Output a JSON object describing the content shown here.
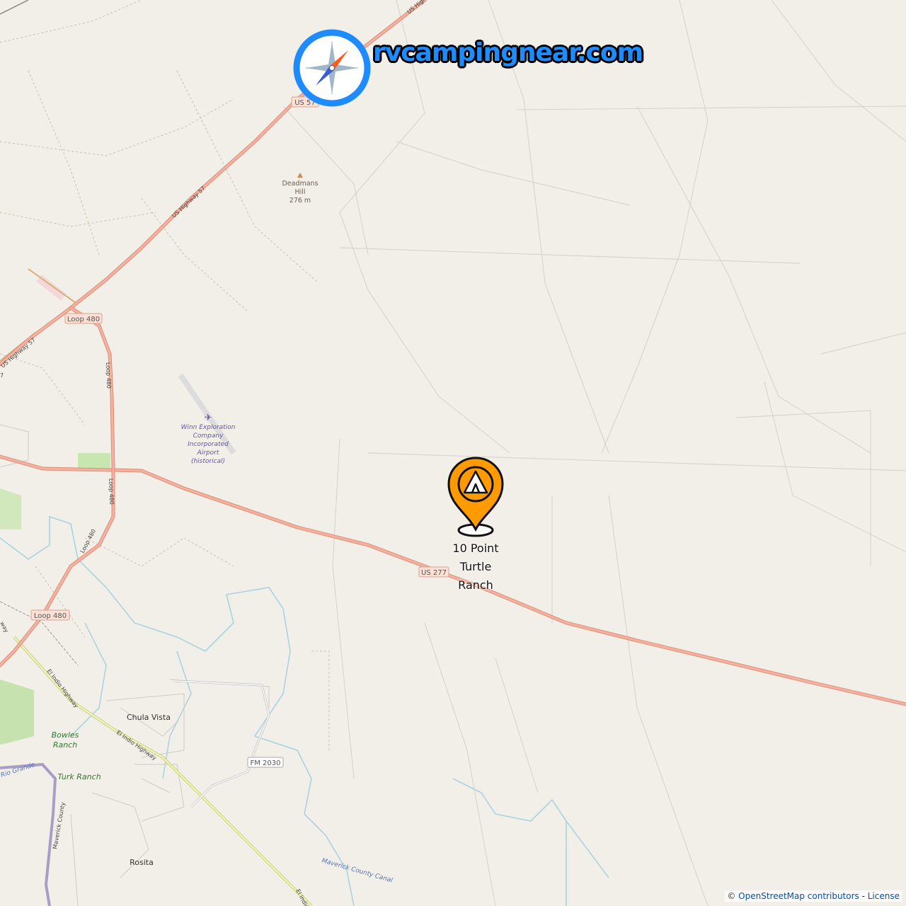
{
  "brand": {
    "site_name": "rvcampingnear.com",
    "colors": {
      "ring": "#1e8cff",
      "text": "#1e8cff",
      "needle_north": "#ff5a1f",
      "needle_south": "#3a5bd9"
    },
    "icon": "compass-icon"
  },
  "marker": {
    "name_lines": [
      "10 Point",
      "Turtle",
      "Ranch"
    ],
    "icon": "tent-pin-icon",
    "color": "#ff9a00"
  },
  "road_shields": [
    {
      "id": "us57-top",
      "text": "US 57"
    },
    {
      "id": "loop480-north",
      "text": "Loop 480"
    },
    {
      "id": "us277",
      "text": "US 277"
    },
    {
      "id": "loop480-south",
      "text": "Loop 480"
    },
    {
      "id": "fm2030",
      "text": "FM 2030"
    }
  ],
  "road_labels": {
    "us_hwy_57_a": "US Highway 57",
    "us_hwy_57_b": "US Highway 57",
    "us_hwy_57_top": "US Highw",
    "loop_480_a": "Loop 480",
    "loop_480_b": "Loop 480",
    "loop_480_c": "Loop 480",
    "el_indio_a": "El Indio Highway",
    "el_indio_b": "El Indio Highway",
    "el_indio_c": "El Indio H",
    "maverick_canal": "Maverick County Canal",
    "maverick_county": "Maverick County",
    "rio_grande": "Rio Grande",
    "edge_7": "7",
    "edge_way": "way"
  },
  "places": {
    "deadmans_hill": [
      "Deadmans",
      "Hill",
      "276 m"
    ],
    "airport": [
      "Winn Exploration",
      "Company",
      "Incorporated",
      "Airport",
      "(historical)"
    ],
    "chula_vista": "Chula Vista",
    "bowles_ranch": [
      "Bowles",
      "Ranch"
    ],
    "turk_ranch": "Turk Ranch",
    "rosita": "Rosita"
  },
  "attribution": {
    "prefix": "©",
    "link_text": "OpenStreetMap contributors",
    "separator": " - ",
    "license_text": "License"
  }
}
